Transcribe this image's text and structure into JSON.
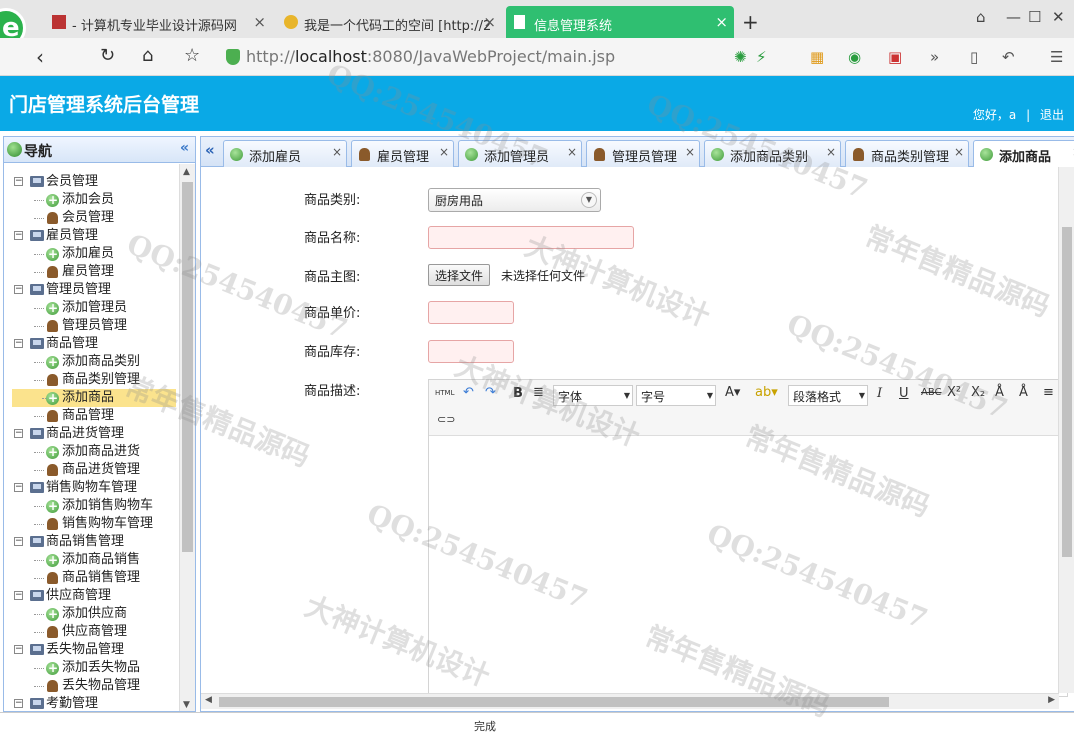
{
  "browser": {
    "tabs": [
      {
        "title": "- 计算机专业毕业设计源码网"
      },
      {
        "title": "我是一个代码工的空间 [http://2"
      },
      {
        "title": "信息管理系统"
      }
    ],
    "new_tab": "+",
    "address": {
      "prefix": "http://",
      "host": "localhost",
      "rest": ":8080/JavaWebProject/main.jsp"
    },
    "more": "»"
  },
  "header": {
    "title": "门店管理系统后台管理",
    "greeting": "您好，a",
    "logout": "退出"
  },
  "sidebar": {
    "title": "导航",
    "collapse": "«",
    "tree": [
      {
        "label": "会员管理",
        "children": [
          "添加会员",
          "会员管理"
        ]
      },
      {
        "label": "雇员管理",
        "children": [
          "添加雇员",
          "雇员管理"
        ]
      },
      {
        "label": "管理员管理",
        "children": [
          "添加管理员",
          "管理员管理"
        ]
      },
      {
        "label": "商品管理",
        "children": [
          "添加商品类别",
          "商品类别管理",
          "添加商品",
          "商品管理"
        ]
      },
      {
        "label": "商品进货管理",
        "children": [
          "添加商品进货",
          "商品进货管理"
        ]
      },
      {
        "label": "销售购物车管理",
        "children": [
          "添加销售购物车",
          "销售购物车管理"
        ]
      },
      {
        "label": "商品销售管理",
        "children": [
          "添加商品销售",
          "商品销售管理"
        ]
      },
      {
        "label": "供应商管理",
        "children": [
          "添加供应商",
          "供应商管理"
        ]
      },
      {
        "label": "丢失物品管理",
        "children": [
          "添加丢失物品",
          "丢失物品管理"
        ]
      },
      {
        "label": "考勤管理",
        "children": []
      }
    ],
    "selected": "添加商品"
  },
  "tabs": [
    {
      "label": "添加雇员",
      "icon": "add-icon"
    },
    {
      "label": "雇员管理",
      "icon": "user-icon"
    },
    {
      "label": "添加管理员",
      "icon": "add-icon"
    },
    {
      "label": "管理员管理",
      "icon": "user-icon"
    },
    {
      "label": "添加商品类别",
      "icon": "add-icon"
    },
    {
      "label": "商品类别管理",
      "icon": "user-icon"
    },
    {
      "label": "添加商品",
      "icon": "add-icon",
      "active": true
    }
  ],
  "form": {
    "category_label": "商品类别:",
    "category_value": "厨房用品",
    "name_label": "商品名称:",
    "image_label": "商品主图:",
    "file_button": "选择文件",
    "file_status": "未选择任何文件",
    "price_label": "商品单价:",
    "stock_label": "商品库存:",
    "desc_label": "商品描述:"
  },
  "editor": {
    "font_family": "字体",
    "font_size": "字号",
    "paragraph": "段落格式",
    "html_btn": "HTML"
  },
  "status_text": "完成",
  "watermarks": [
    "QQ:254540457",
    "大神计算机设计",
    "常年售精品源码"
  ]
}
